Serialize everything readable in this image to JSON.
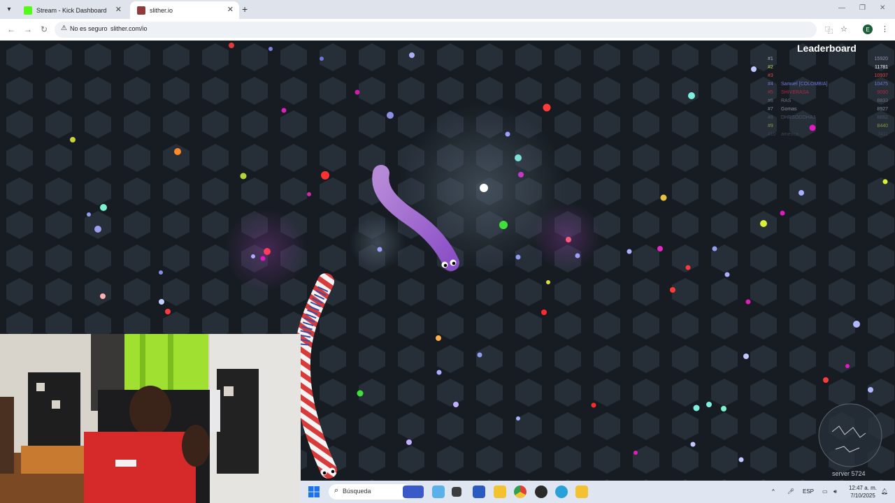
{
  "browser": {
    "tabs": [
      {
        "title": "Stream - Kick Dashboard",
        "active": false
      },
      {
        "title": "slither.io",
        "active": true
      }
    ],
    "address": {
      "security_label": "No es seguro",
      "url": "slither.com/io"
    },
    "profile_initial": "E",
    "accent": "#1a73e8"
  },
  "game": {
    "leaderboard": {
      "title": "Leaderboard",
      "entries": [
        {
          "rank": "#1",
          "name": "",
          "score": "15920"
        },
        {
          "rank": "#2",
          "name": "",
          "score": "11781"
        },
        {
          "rank": "#3",
          "name": "",
          "score": "10937"
        },
        {
          "rank": "#4",
          "name": "Samuel [COLOMBIA]",
          "score": "10475"
        },
        {
          "rank": "#5",
          "name": "SHIVERASA",
          "score": "9090"
        },
        {
          "rank": "#6",
          "name": "RAS",
          "score": "8833"
        },
        {
          "rank": "#7",
          "name": "Gomas",
          "score": "8927"
        },
        {
          "rank": "#8",
          "name": "DHRSODOHAJ",
          "score": "8652"
        },
        {
          "rank": "#9",
          "name": "",
          "score": "8440"
        },
        {
          "rank": "#10",
          "name": "america",
          "score": "7411"
        }
      ]
    },
    "server_label": "server 5724"
  },
  "taskbar": {
    "search_placeholder": "Búsqueda",
    "language": "ESP",
    "time": "12:47 a. m.",
    "date": "7/10/2025"
  }
}
